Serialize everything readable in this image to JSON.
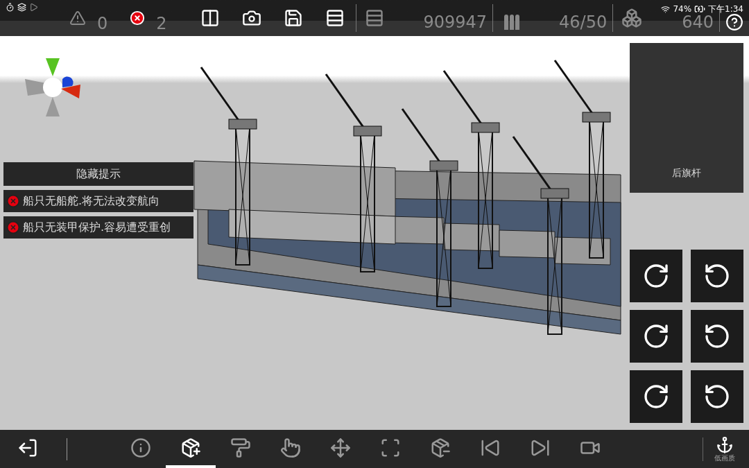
{
  "status_bar": {
    "battery": "74%",
    "time": "下午1:34"
  },
  "toolbar": {
    "warnings": "0",
    "errors": "2",
    "funds": "909947",
    "ammo": "46/50",
    "parts": "640"
  },
  "hints": {
    "hide_button": "隐藏提示",
    "messages": [
      {
        "kind": "error",
        "text": "船只无船舵.将无法改变航向"
      },
      {
        "kind": "error",
        "text": "船只无装甲保护.容易遭受重创"
      }
    ]
  },
  "preview": {
    "label": "后旗杆"
  },
  "bottom_tools": [
    {
      "kind": "exit",
      "selected": false
    },
    {
      "kind": "info",
      "selected": false
    },
    {
      "kind": "add",
      "selected": true
    },
    {
      "kind": "paint",
      "selected": false
    },
    {
      "kind": "pick",
      "selected": false
    },
    {
      "kind": "move",
      "selected": false
    },
    {
      "kind": "frame",
      "selected": false
    },
    {
      "kind": "remove",
      "selected": false
    },
    {
      "kind": "prev",
      "selected": false
    },
    {
      "kind": "next",
      "selected": false
    },
    {
      "kind": "camera",
      "selected": false
    }
  ],
  "quality": "低画质"
}
